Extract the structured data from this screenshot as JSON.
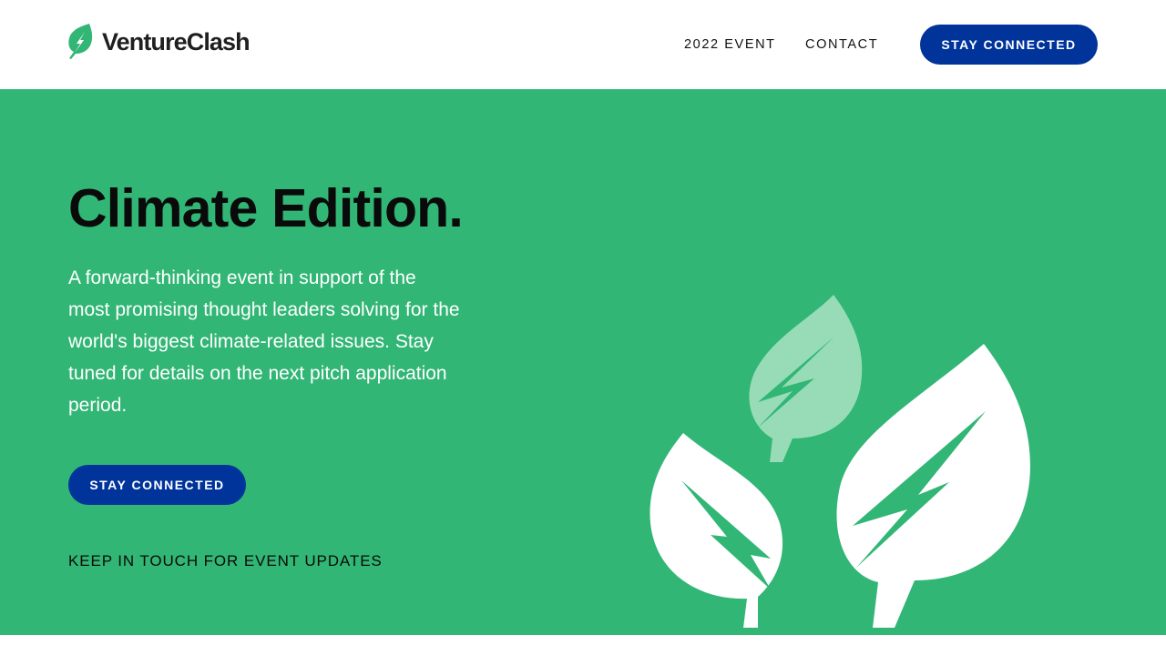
{
  "brand": {
    "name": "VentureClash",
    "logo_icon": "leaf-lightning-icon",
    "accent_green": "#31b675",
    "button_blue": "#00349b"
  },
  "nav": {
    "items": [
      {
        "label": "2022 EVENT"
      },
      {
        "label": "CONTACT"
      }
    ],
    "cta_label": "STAY CONNECTED"
  },
  "hero": {
    "title": "Climate Edition.",
    "description": "A forward-thinking event in support of the most promising thought leaders solving for the world's biggest climate-related issues. Stay tuned for details on the next pitch application period.",
    "cta_label": "STAY CONNECTED",
    "updates_text": "KEEP IN TOUCH FOR EVENT UPDATES",
    "illustration": "leaves-lightning-illustration"
  }
}
